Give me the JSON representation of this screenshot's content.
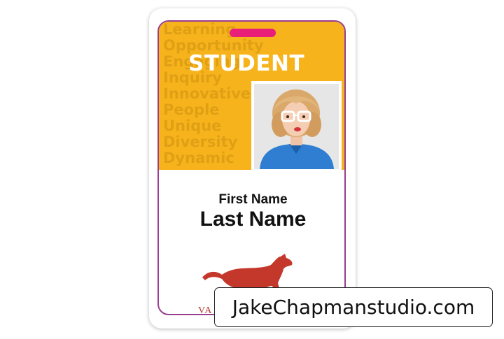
{
  "card": {
    "badge_title": "STUDENT",
    "first_name": "First Name",
    "last_name": "Last Name",
    "school_text": "VA",
    "background_words": [
      "Learning",
      "Opportunity",
      "Engaging",
      "Inquiry",
      "Innovative",
      "People",
      "Unique",
      "Diversity",
      "Dynamic"
    ],
    "mascot_icon": "cougar-icon"
  },
  "watermark": {
    "text": "JakeChapmanstudio.com"
  },
  "colors": {
    "banner": "#f6b31b",
    "slot": "#e91e78",
    "frame_border": "#9a3d8f",
    "mascot": "#c4382c"
  }
}
